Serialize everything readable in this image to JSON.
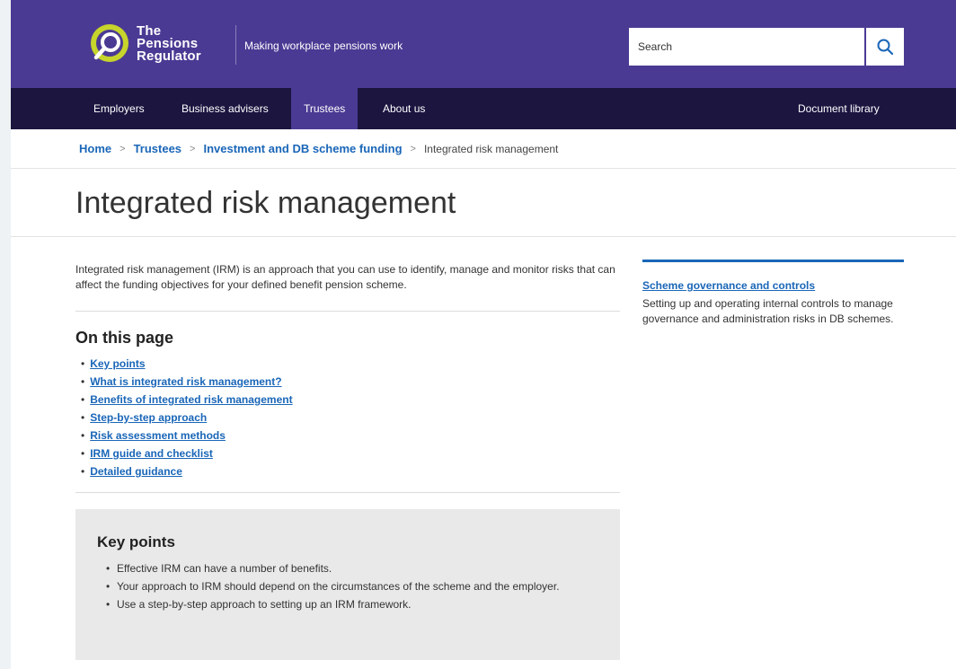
{
  "header": {
    "logo_lines": [
      "The",
      "Pensions",
      "Regulator"
    ],
    "tagline": "Making workplace pensions work",
    "search_placeholder": "Search"
  },
  "nav": {
    "items": [
      {
        "label": "Employers"
      },
      {
        "label": "Business advisers"
      },
      {
        "label": "Trustees"
      },
      {
        "label": "About us"
      }
    ],
    "active": "Trustees",
    "right_link": "Document library"
  },
  "breadcrumb": {
    "items": [
      "Home",
      "Trustees",
      "Investment and DB scheme funding"
    ],
    "current": "Integrated risk management"
  },
  "page_title": "Integrated risk management",
  "intro": "Integrated risk management (IRM) is an approach that you can use to identify, manage and monitor risks that can affect the funding objectives for your defined benefit pension scheme.",
  "on_this_page": {
    "heading": "On this page",
    "links": [
      "Key points",
      "What is integrated risk management?",
      "Benefits of integrated risk management",
      "Step-by-step approach",
      "Risk assessment methods",
      "IRM guide and checklist",
      "Detailed guidance"
    ]
  },
  "key_points": {
    "heading": "Key points",
    "items": [
      "Effective IRM can have a number of benefits.",
      "Your approach to IRM should depend on the circumstances of the scheme and the employer.",
      "Use a step-by-step approach to setting up an IRM framework."
    ]
  },
  "sidebar": {
    "link": "Scheme governance and controls",
    "description": "Setting up and operating internal controls to manage governance and administration risks in DB schemes."
  },
  "colors": {
    "header_purple": "#4b3a93",
    "nav_dark": "#1b1540",
    "link_blue": "#1a66b8",
    "logo_green": "#c6d42b"
  }
}
